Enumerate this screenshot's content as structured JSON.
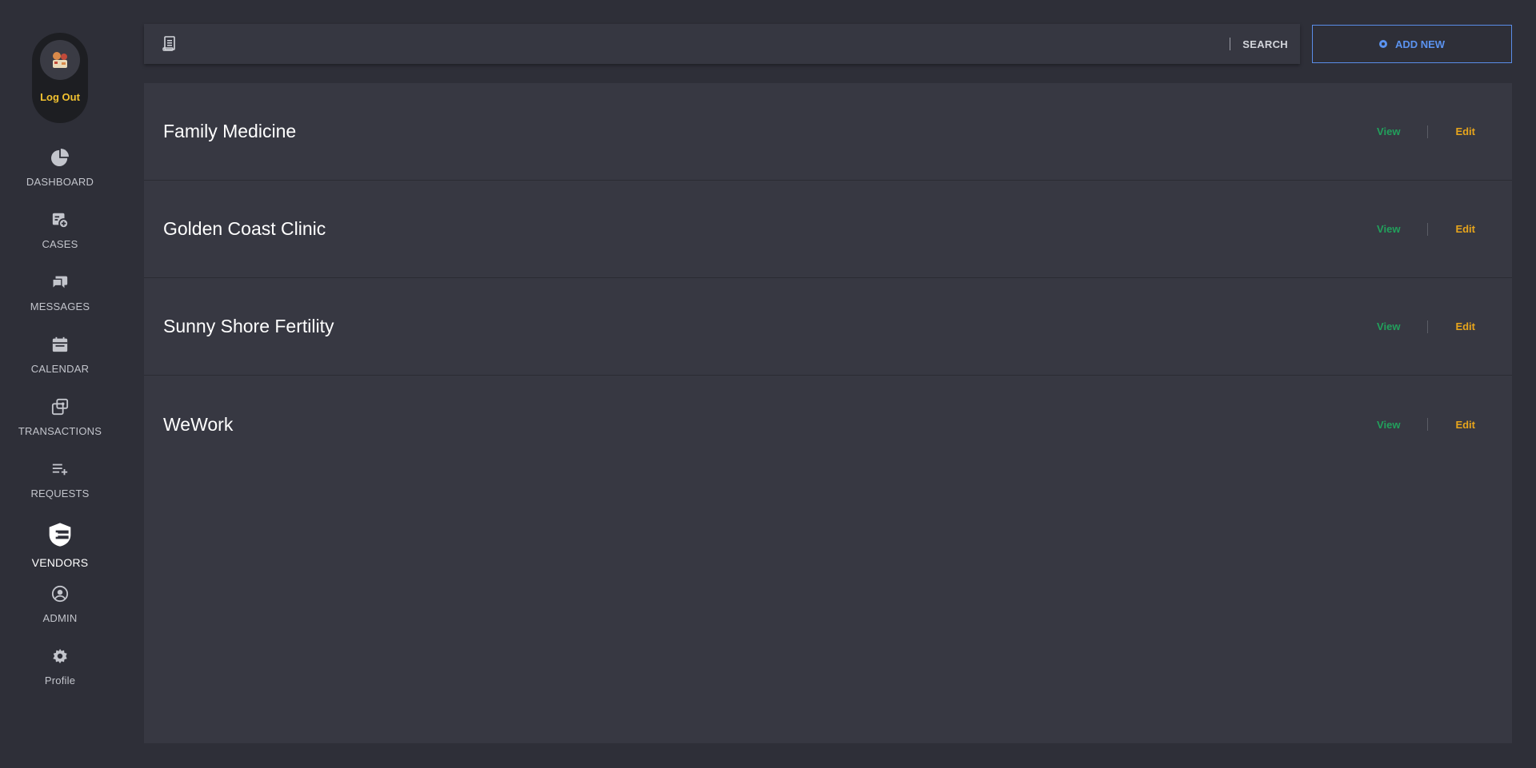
{
  "sidebar": {
    "user": {
      "avatar_icon": "avatar-illustration",
      "logout_label": "Log Out"
    },
    "items": [
      {
        "label": "DASHBOARD",
        "icon": "pie-chart-icon",
        "active": false
      },
      {
        "label": "CASES",
        "icon": "cases-icon",
        "active": false
      },
      {
        "label": "MESSAGES",
        "icon": "chat-bubbles-icon",
        "active": false
      },
      {
        "label": "CALENDAR",
        "icon": "calendar-icon",
        "active": false
      },
      {
        "label": "TRANSACTIONS",
        "icon": "transactions-icon",
        "active": false
      },
      {
        "label": "REQUESTS",
        "icon": "playlist-add-icon",
        "active": false
      },
      {
        "label": "VENDORS",
        "icon": "vendor-shield-icon",
        "active": true
      },
      {
        "label": "ADMIN",
        "icon": "user-circle-icon",
        "active": false
      },
      {
        "label": "Profile",
        "icon": "gear-icon",
        "active": false
      }
    ]
  },
  "toolbar": {
    "search_value": "",
    "search_placeholder": "",
    "search_label": "SEARCH",
    "add_label": "ADD NEW"
  },
  "vendors": [
    {
      "name": "Family Medicine",
      "view_label": "View",
      "edit_label": "Edit"
    },
    {
      "name": "Golden Coast Clinic",
      "view_label": "View",
      "edit_label": "Edit"
    },
    {
      "name": "Sunny Shore Fertility",
      "view_label": "View",
      "edit_label": "Edit"
    },
    {
      "name": "WeWork",
      "view_label": "View",
      "edit_label": "Edit"
    }
  ],
  "colors": {
    "background": "#2e2f38",
    "panel": "#373842",
    "logout": "#f2c230",
    "accent_blue": "#5b93f0",
    "view_green": "#22a05c",
    "edit_orange": "#e7a51c"
  }
}
